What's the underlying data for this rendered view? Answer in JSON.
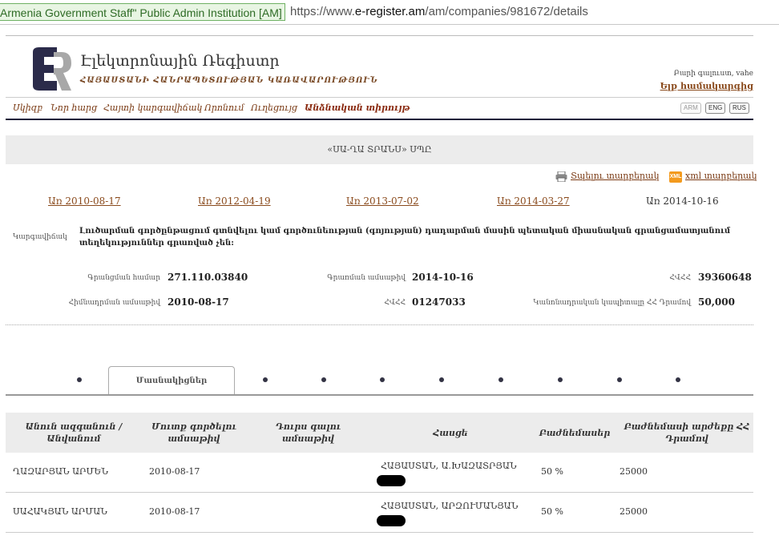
{
  "browser": {
    "ev_label": "Armenia Government Staff\"  Public Admin Institution [AM]",
    "url_scheme": "https://www.",
    "url_domain": "e-register.am",
    "url_path": "/am/companies/981672/details"
  },
  "header": {
    "title": "Էլեկտրոնային Ռեգիստր",
    "subtitle": "ՀԱՅԱՍՏԱՆԻ ՀԱՆՐԱՊԵՏՈՒԹՅԱՆ ԿԱՌԱՎԱՐՈՒԹՅՈՒՆ",
    "welcome": "Բարի գալուստ, vahe",
    "logout": "Ելք համակարգից"
  },
  "nav": {
    "items": [
      "Սկիզբ",
      "Նոր հարց",
      "Հայտի կարգավիճակ",
      "Որոնում",
      "Ուղեցույց",
      "Անձնական տիրույթ"
    ],
    "languages": [
      "ARM",
      "ENG",
      "RUS"
    ]
  },
  "company": {
    "name": "«ՍԱ-ՂԱ ՏՐԱՆՍ» ՍՊԸ",
    "print_link": "Տպելու տարբերակ",
    "xml_link": "xml տարբերակ",
    "xml_icon_text": "XML"
  },
  "versions": [
    "Առ 2010-08-17",
    "Առ 2012-04-19",
    "Առ 2013-07-02",
    "Առ 2014-03-27",
    "Առ 2014-10-16"
  ],
  "details": {
    "status_label": "Կարգավիճակ",
    "status_text": "Լուծարման գործընթացում գտնվելու կամ գործունեության (գոյության) դադարման մասին պետական միասնական գրանցամատյանում տեղեկություններ գրառված չեն:",
    "reg_number_label": "Գրանցման համար",
    "reg_number": "271.110.03840",
    "reg_date_label": "Գրառման ամսաթիվ",
    "reg_date": "2014-10-16",
    "tax_id_label": "ՀՎՀՀ",
    "tax_id": "39360648",
    "found_date_label": "Հիմնադրման ամսաթիվ",
    "found_date": "2010-08-17",
    "hvhh_label": "ՀՎՀՀ",
    "hvhh": "01247033",
    "capital_label": "Կանոնադրական կապիտալը ՀՀ Դրամով",
    "capital": "50,000"
  },
  "tabs": {
    "active_label": "Մասնակիցներ"
  },
  "table": {
    "headers": [
      "Անուն ազգանուն / Անվանում",
      "Մուտք գործելու ամսաթիվ",
      "Դուրս գալու ամսաթիվ",
      "Հասցե",
      "Բաժնեմասեր",
      "Բաժնեմասի արժեքը ՀՀ Դրամով"
    ],
    "rows": [
      {
        "name": "ՂԱԶԱՐՅԱՆ ԱՐՄԵՆ",
        "entry": "2010-08-17",
        "exit": "",
        "address": "ՀԱՅԱՍՏԱՆ, Ա.ԽԱԶԱՏՐՅԱՆ",
        "share": "50 %",
        "value": "25000"
      },
      {
        "name": "ՍԱՀԱԿՅԱՆ ԱՐՄԱՆ",
        "entry": "2010-08-17",
        "exit": "",
        "address": "ՀԱՅԱՍՏԱՆ, ԱՐԶՈՒՄԱՆՅԱՆ",
        "share": "50 %",
        "value": "25000"
      }
    ]
  },
  "colors": {
    "brand_dark": "#2b2b4a",
    "link": "#8a4a1c",
    "ev_green": "#2e6b25"
  }
}
